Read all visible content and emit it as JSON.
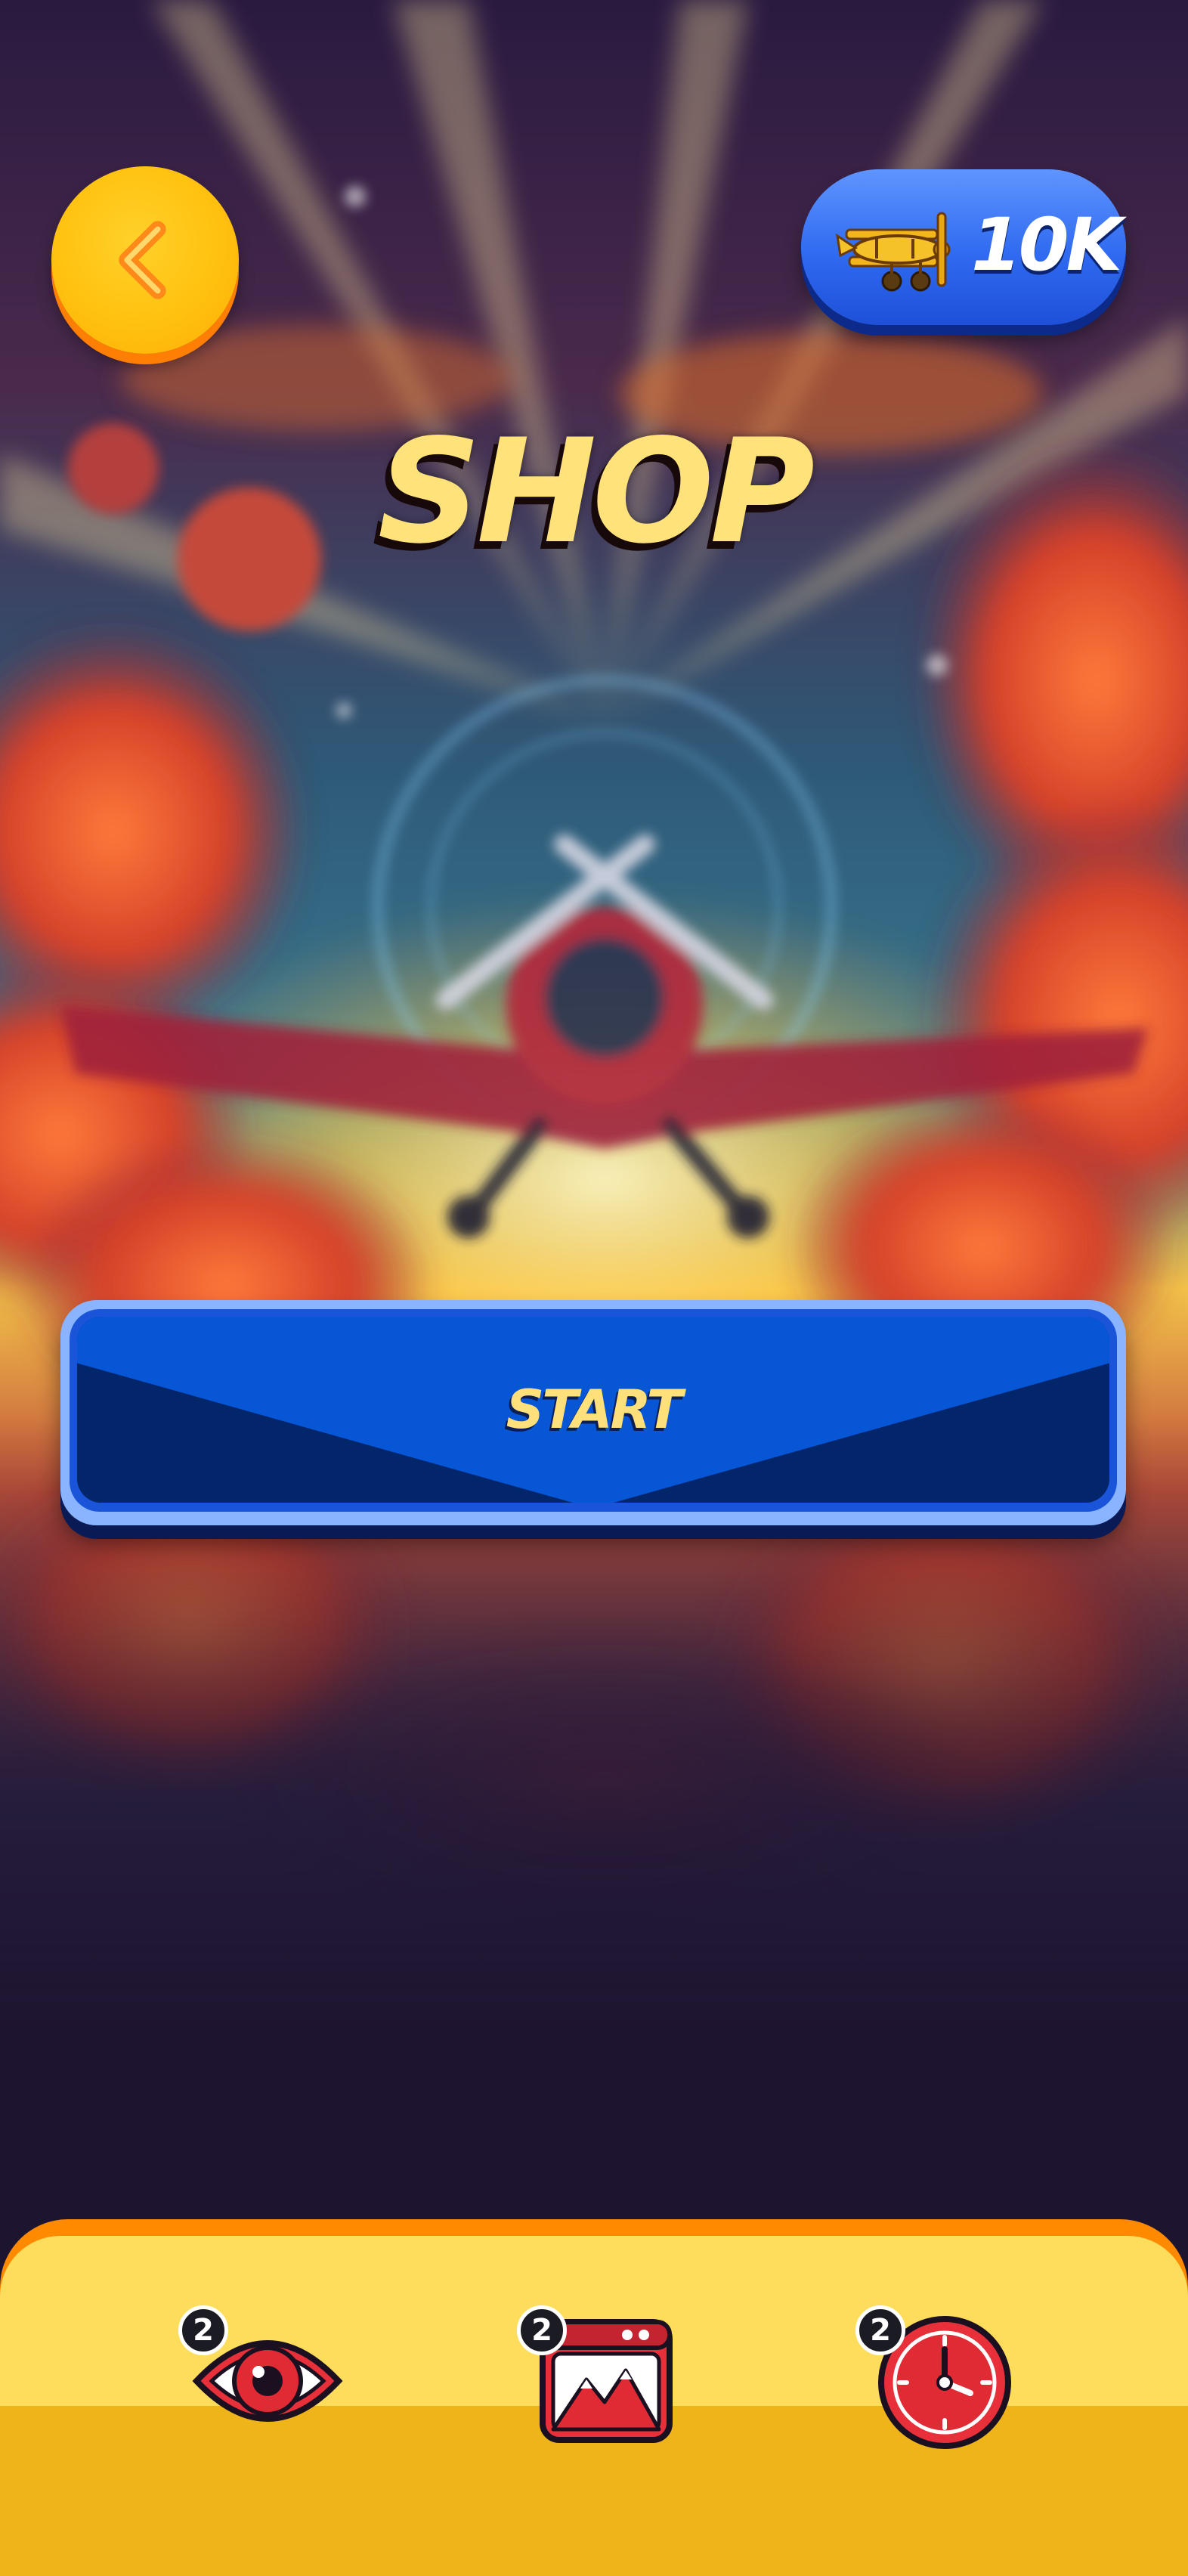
{
  "header": {
    "back_icon": "chevron-left-icon",
    "balance": {
      "icon": "biplane-icon",
      "value": "10K"
    }
  },
  "page": {
    "title": "SHOP"
  },
  "start_button": {
    "label": "START"
  },
  "bottom_bar": {
    "items": [
      {
        "name": "eye",
        "icon": "eye-icon",
        "count": "2"
      },
      {
        "name": "landscape",
        "icon": "mountain-image-icon",
        "count": "2"
      },
      {
        "name": "clock",
        "icon": "clock-icon",
        "count": "2"
      }
    ]
  },
  "colors": {
    "background": "#1d1430",
    "back_button": "#ffc10f",
    "balance_pill": "#2f6af0",
    "title": "#ffe27a",
    "start_button": "#1a54d8",
    "start_label": "#ffe07a",
    "bottom_bar_top": "#ffdd5c",
    "bottom_bar_bottom": "#f0b41b",
    "bottom_bar_edge": "#ff8a00"
  }
}
